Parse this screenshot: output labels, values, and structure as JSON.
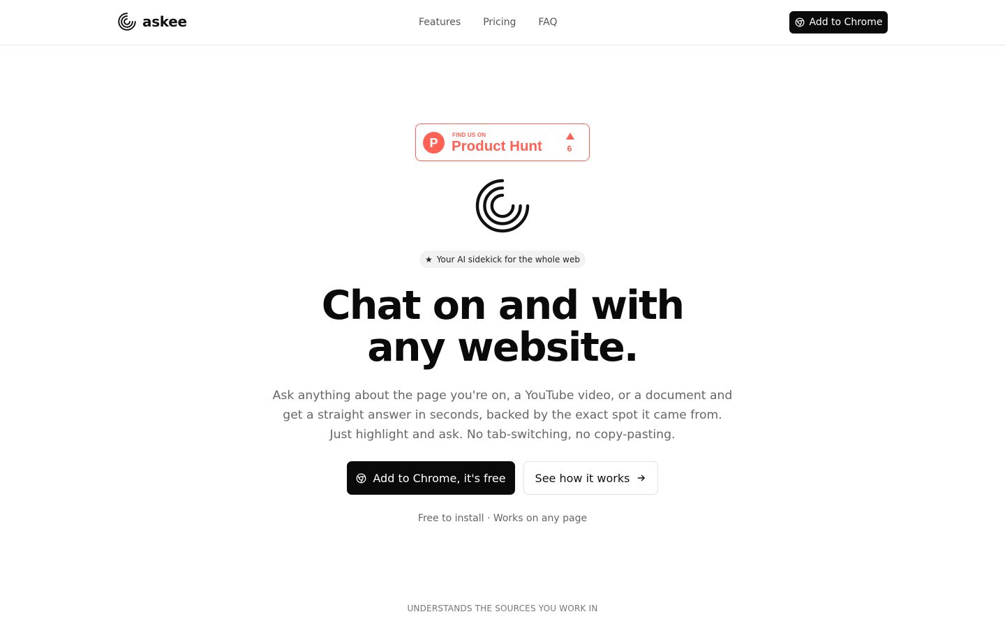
{
  "header": {
    "brand_name": "askee",
    "nav": [
      "Features",
      "Pricing",
      "FAQ"
    ],
    "cta_label": "Add to Chrome"
  },
  "product_hunt": {
    "small_text": "FIND US ON",
    "big_text": "Product Hunt",
    "logo_letter": "P",
    "upvotes": "6",
    "color": "#ff6154"
  },
  "hero": {
    "pill_text": "Your AI sidekick for the whole web",
    "headline_line1": "Chat on and with",
    "headline_line2": "any website.",
    "subtext": "Ask anything about the page you're on, a YouTube video, or a document and get a straight answer in seconds, backed by the exact spot it came from. Just highlight and ask. No tab-switching, no copy-pasting.",
    "primary_cta": "Add to Chrome, it's free",
    "secondary_cta": "See how it works",
    "fine_print": "Free to install · Works on any page"
  },
  "sources_section": {
    "label": "UNDERSTANDS THE SOURCES YOU WORK IN"
  },
  "icons": {
    "brand": "spiral-logo-icon",
    "chrome": "chrome-icon",
    "star": "star-icon",
    "arrow": "arrow-right-icon",
    "upvote": "upvote-triangle-icon"
  },
  "colors": {
    "primary": "#0a0a0a",
    "accent_product_hunt": "#ff6154",
    "muted_text": "#666666",
    "pill_bg": "#f2f2f2"
  }
}
